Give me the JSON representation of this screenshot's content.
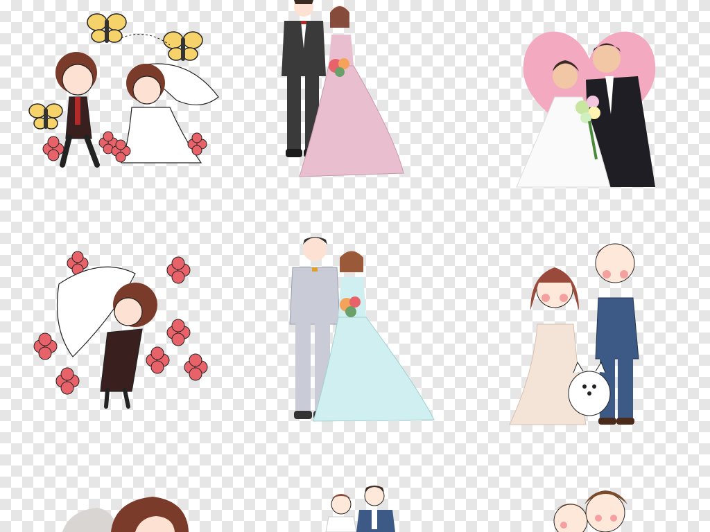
{
  "canvas": {
    "background": "transparency-checkerboard",
    "checker_colors": [
      "#ffffff",
      "#e6e6e6"
    ]
  },
  "colors": {
    "flower": "#e8626a",
    "butterfly": "#f5d36a",
    "heart": "#f3a9bf",
    "suit_dark": "#3a3a3a",
    "suit_grey": "#c9ccd6",
    "suit_navy": "#3d5a86",
    "dress_pink": "#e9bfd0",
    "dress_mint": "#cfeff0",
    "dress_cream": "#f4e4d8",
    "hair_brown": "#7a3b2a"
  },
  "clipart": [
    {
      "id": "chibi-couple-butterflies",
      "icons": [
        "butterfly-icon",
        "flower-icon"
      ]
    },
    {
      "id": "couple-pink-gown"
    },
    {
      "id": "couple-pink-heart",
      "icons": [
        "heart-icon"
      ]
    },
    {
      "id": "chibi-couple-veil-flowers",
      "icons": [
        "flower-icon"
      ]
    },
    {
      "id": "couple-grey-suit-mint-gown"
    },
    {
      "id": "couple-navy-suit-dog",
      "icons": [
        "dog-icon"
      ]
    },
    {
      "id": "chibi-couple-partial"
    },
    {
      "id": "couple-navy-suit-partial"
    },
    {
      "id": "couple-faces-partial"
    }
  ]
}
